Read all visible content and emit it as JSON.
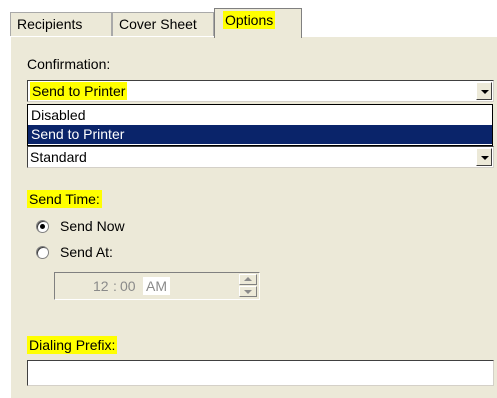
{
  "tabs": [
    {
      "label": "Recipients"
    },
    {
      "label": "Cover Sheet"
    },
    {
      "label": "Options"
    }
  ],
  "confirmation": {
    "label": "Confirmation:",
    "selected": "Send to Printer",
    "options": [
      "Disabled",
      "Send to Printer"
    ]
  },
  "second_combo": {
    "value": "Standard"
  },
  "send_time": {
    "label": "Send Time:",
    "send_now_label": "Send Now",
    "send_at_label": "Send At:",
    "send_now_checked": true,
    "time_hour": "12",
    "time_separator": ":",
    "time_minute": "00",
    "time_ampm": "AM"
  },
  "dialing_prefix": {
    "label": "Dialing Prefix:",
    "value": ""
  },
  "colors": {
    "highlight": "#ffff00",
    "panel": "#ece9d8",
    "selection": "#0a246a"
  }
}
